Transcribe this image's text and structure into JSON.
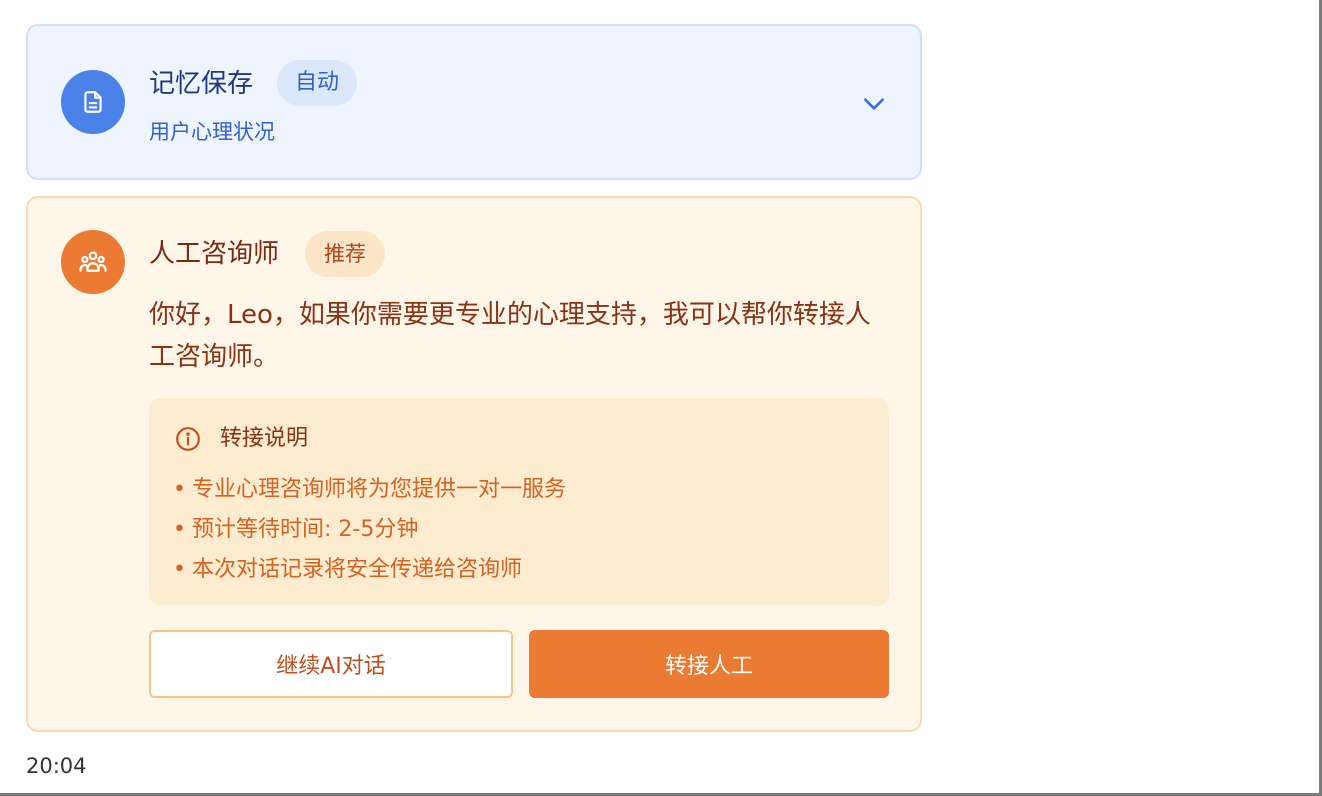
{
  "memory_card": {
    "title": "记忆保存",
    "badge": "自动",
    "subtitle": "用户心理状况",
    "icon": "document-icon",
    "toggle_icon": "chevron-down-icon",
    "accent": "#4a82ea"
  },
  "counselor_card": {
    "title": "人工咨询师",
    "badge": "推荐",
    "icon": "group-icon",
    "message": "你好，Leo，如果你需要更专业的心理支持，我可以帮你转接人工咨询师。",
    "info": {
      "icon": "info-icon",
      "title": "转接说明",
      "items": [
        "专业心理咨询师将为您提供一对一服务",
        "预计等待时间: 2-5分钟",
        "本次对话记录将安全传递给咨询师"
      ]
    },
    "buttons": {
      "continue_label": "继续AI对话",
      "transfer_label": "转接人工"
    },
    "accent": "#eb7a32"
  },
  "timestamp": "20:04"
}
